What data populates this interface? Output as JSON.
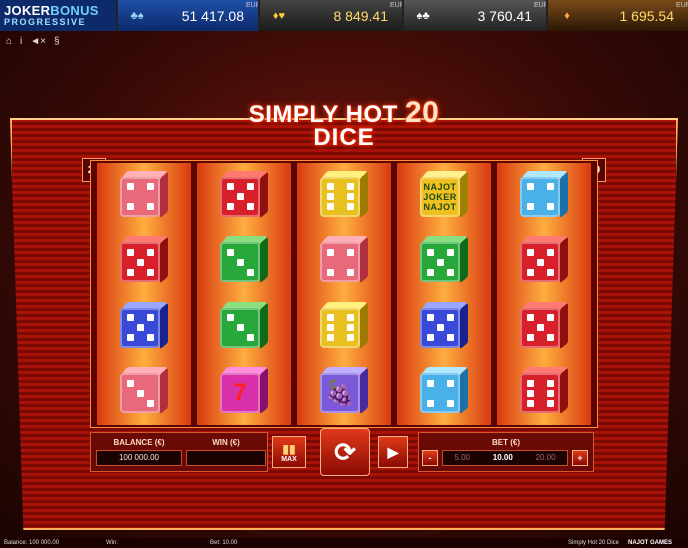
{
  "jackpot": {
    "logo_line1": "JOKER",
    "logo_line1b": "BONUS",
    "logo_line2": "PROGRESSIVE",
    "levels": [
      {
        "icon": "clubs-card-icon",
        "glyph": "♣♠",
        "value": "51 417.08",
        "currency": "EUR"
      },
      {
        "icon": "gold-card-icon",
        "glyph": "♦♥",
        "value": "8 849.41",
        "currency": "EUR"
      },
      {
        "icon": "silver-card-icon",
        "glyph": "♠♣",
        "value": "3 760.41",
        "currency": "EUR"
      },
      {
        "icon": "bronze-card-icon",
        "glyph": "♦",
        "value": "1 695.54",
        "currency": "EUR"
      }
    ]
  },
  "toolbar": {
    "home": "⌂",
    "info": "i",
    "sound": "◄×",
    "rules": "§"
  },
  "title": {
    "line1": "SIMPLY HOT",
    "number": "20",
    "line2": "DICE"
  },
  "badge": "20",
  "reels": [
    [
      {
        "color": "pink",
        "kind": "pips",
        "n": 4
      },
      {
        "color": "red",
        "kind": "pips",
        "n": 5
      },
      {
        "color": "blue",
        "kind": "pips",
        "n": 5
      },
      {
        "color": "pink",
        "kind": "pips",
        "n": 3
      }
    ],
    [
      {
        "color": "red",
        "kind": "pips",
        "n": 5
      },
      {
        "color": "green",
        "kind": "pips",
        "n": 3
      },
      {
        "color": "green",
        "kind": "pips",
        "n": 3
      },
      {
        "color": "magenta",
        "kind": "glyph",
        "text": "7"
      }
    ],
    [
      {
        "color": "yellow",
        "kind": "pips",
        "n": 6
      },
      {
        "color": "pink",
        "kind": "pips",
        "n": 4
      },
      {
        "color": "yellow",
        "kind": "pips",
        "n": 6
      },
      {
        "color": "purple",
        "kind": "glyph",
        "text": "🍇"
      }
    ],
    [
      {
        "color": "joker",
        "kind": "joker",
        "text": "NAJOT JOKER NAJOT"
      },
      {
        "color": "green",
        "kind": "pips",
        "n": 5
      },
      {
        "color": "blue",
        "kind": "pips",
        "n": 5
      },
      {
        "color": "lightblue",
        "kind": "pips",
        "n": 4
      }
    ],
    [
      {
        "color": "lightblue",
        "kind": "pips",
        "n": 4
      },
      {
        "color": "red",
        "kind": "pips",
        "n": 5
      },
      {
        "color": "red",
        "kind": "pips",
        "n": 5
      },
      {
        "color": "red",
        "kind": "pips",
        "n": 6
      }
    ]
  ],
  "panel": {
    "balance_label": "BALANCE (€)",
    "balance_value": "100 000.00",
    "win_label": "WIN (€)",
    "win_value": "",
    "max_label": "MAX",
    "bet_label": "BET (€)",
    "bet_options": [
      "5.00",
      "10.00",
      "20.00"
    ],
    "minus": "-",
    "plus": "+"
  },
  "footer": {
    "balance": "Balance: 100 000.00",
    "win": "Win:",
    "bet": "Bet: 10.00",
    "game": "Simply Hot 20 Dice",
    "brand": "NAJOT GAMES"
  },
  "colors": {
    "pink": [
      "#e86a7a",
      "#ffb0b8",
      "#b03040"
    ],
    "red": [
      "#d8202a",
      "#ff7a70",
      "#901010"
    ],
    "blue": [
      "#3a4ad8",
      "#9aa6ff",
      "#1a2290"
    ],
    "green": [
      "#28a83a",
      "#8ae080",
      "#0f6a1a"
    ],
    "yellow": [
      "#e8c020",
      "#fff080",
      "#a07a00"
    ],
    "magenta": [
      "#d830a8",
      "#ff90e0",
      "#8a1070"
    ],
    "purple": [
      "#7a5ad8",
      "#c0b0ff",
      "#4a2aa0"
    ],
    "lightblue": [
      "#4ab0e8",
      "#b0e8ff",
      "#1a70a8"
    ],
    "joker": [
      "#f0c020",
      "#fff090",
      "#a08000"
    ]
  }
}
